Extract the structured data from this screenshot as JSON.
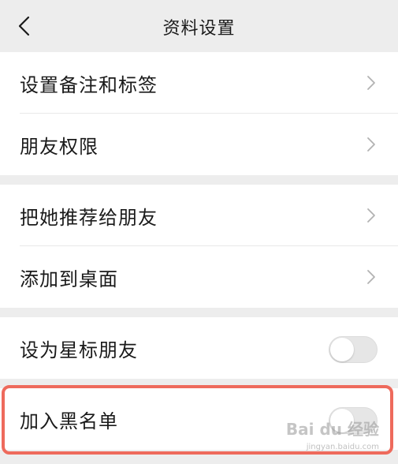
{
  "header": {
    "title": "资料设置",
    "back_icon": "chevron-left-icon"
  },
  "groups": [
    {
      "rows": [
        {
          "label": "设置备注和标签",
          "control": "chevron-right-icon"
        },
        {
          "label": "朋友权限",
          "control": "chevron-right-icon"
        }
      ]
    },
    {
      "rows": [
        {
          "label": "把她推荐给朋友",
          "control": "chevron-right-icon"
        },
        {
          "label": "添加到桌面",
          "control": "chevron-right-icon"
        }
      ]
    },
    {
      "rows": [
        {
          "label": "设为星标朋友",
          "control": "toggle",
          "toggle_on": false
        }
      ]
    },
    {
      "rows": [
        {
          "label": "加入黑名单",
          "control": "toggle",
          "toggle_on": false
        }
      ]
    }
  ],
  "watermark": {
    "brand": "Bai du 经验",
    "url": "jingyan.baidu.com"
  },
  "colors": {
    "background": "#ededed",
    "row_background": "#ffffff",
    "highlight": "#ee6a5c",
    "chevron": "#b2b2b2"
  }
}
